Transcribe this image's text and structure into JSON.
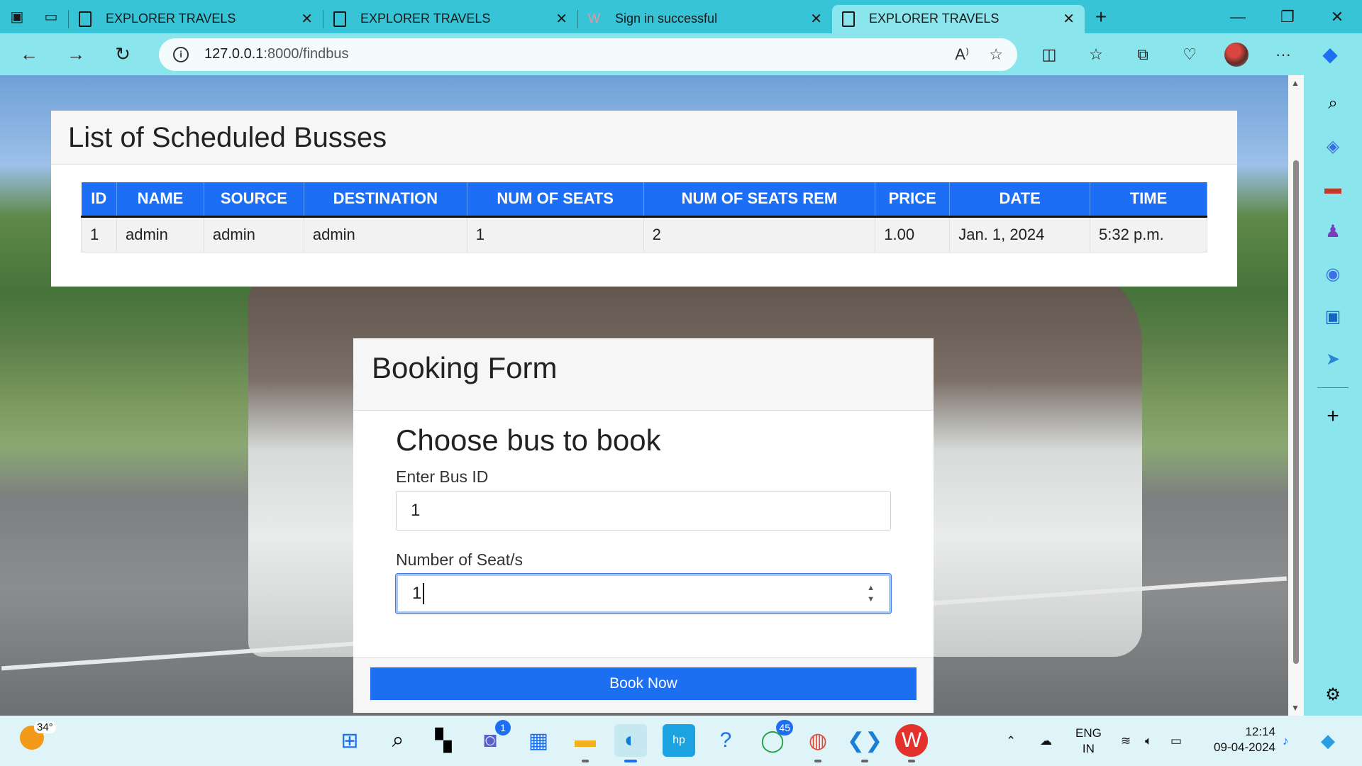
{
  "browser": {
    "tabs": [
      {
        "title": "EXPLORER TRAVELS",
        "active": false
      },
      {
        "title": "EXPLORER TRAVELS",
        "active": false
      },
      {
        "title": "Sign in successful",
        "active": false
      },
      {
        "title": "EXPLORER TRAVELS",
        "active": true
      }
    ],
    "url_host": "127.0.0.1",
    "url_rest": ":8000/findbus"
  },
  "list": {
    "title": "List of Scheduled Busses",
    "columns": [
      "ID",
      "NAME",
      "SOURCE",
      "DESTINATION",
      "NUM OF SEATS",
      "NUM OF SEATS REM",
      "PRICE",
      "DATE",
      "TIME"
    ],
    "rows": [
      [
        "1",
        "admin",
        "admin",
        "admin",
        "1",
        "2",
        "1.00",
        "Jan. 1, 2024",
        "5:32 p.m."
      ]
    ]
  },
  "booking": {
    "header": "Booking Form",
    "heading": "Choose bus to book",
    "bus_id_label": "Enter Bus ID",
    "bus_id_value": "1",
    "seats_label": "Number of Seat/s",
    "seats_value": "1",
    "submit_label": "Book Now"
  },
  "taskbar": {
    "temperature": "34°",
    "teams_badge": "1",
    "whatsapp_badge": "45",
    "language_top": "ENG",
    "language_bottom": "IN",
    "time": "12:14",
    "date": "09-04-2024"
  }
}
